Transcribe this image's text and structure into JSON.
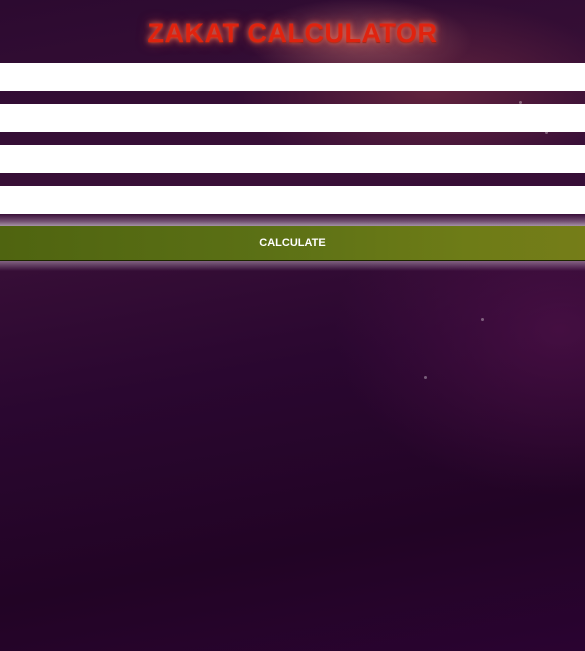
{
  "header": {
    "title": "ZAKAT CALCULATOR"
  },
  "form": {
    "fields": [
      {
        "value": "",
        "placeholder": ""
      },
      {
        "value": "",
        "placeholder": ""
      },
      {
        "value": "",
        "placeholder": ""
      },
      {
        "value": "",
        "placeholder": ""
      }
    ],
    "calculate_label": "CALCULATE"
  },
  "colors": {
    "title": "#e0230f",
    "button": "#5b7015",
    "background": "#2a0730",
    "field": "#ffffff"
  }
}
